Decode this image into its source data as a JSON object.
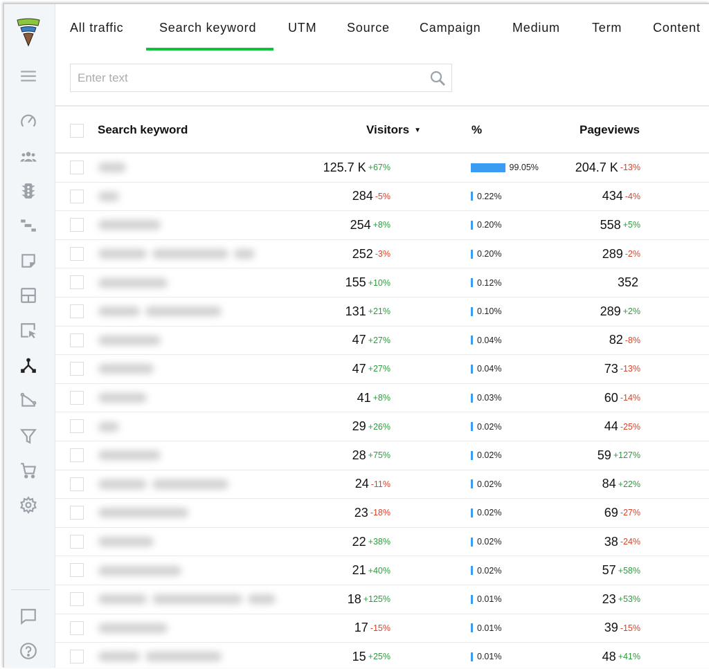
{
  "sidebar": {
    "logo": "funnel-logo",
    "items": [
      {
        "name": "menu",
        "icon": "hamburger-menu-icon",
        "active": false
      },
      {
        "name": "dashboard",
        "icon": "speedometer-icon",
        "active": false
      },
      {
        "name": "visitors",
        "icon": "users-group-icon",
        "active": false
      },
      {
        "name": "traffic",
        "icon": "traffic-light-icon",
        "active": false
      },
      {
        "name": "timeline",
        "icon": "gantt-steps-icon",
        "active": false
      },
      {
        "name": "notes",
        "icon": "sticky-note-icon",
        "active": false
      },
      {
        "name": "layout",
        "icon": "layout-grid-icon",
        "active": false
      },
      {
        "name": "clicks",
        "icon": "cursor-click-icon",
        "active": false
      },
      {
        "name": "utm",
        "icon": "branch-nodes-icon",
        "active": true
      },
      {
        "name": "trends",
        "icon": "trend-line-icon",
        "active": false
      },
      {
        "name": "funnels",
        "icon": "funnel-filter-icon",
        "active": false
      },
      {
        "name": "ecommerce",
        "icon": "shopping-cart-icon",
        "active": false
      },
      {
        "name": "settings",
        "icon": "gear-icon",
        "active": false
      }
    ],
    "bottom_items": [
      {
        "name": "feedback",
        "icon": "chat-bubble-icon"
      },
      {
        "name": "help",
        "icon": "help-circle-icon"
      }
    ],
    "colors": {
      "icon": "#9aa1a8",
      "active_icon": "#222222"
    }
  },
  "tabs": [
    {
      "label": "All traffic",
      "active": false
    },
    {
      "label": "Search keyword",
      "active": true
    },
    {
      "label": "UTM",
      "active": false
    },
    {
      "label": "Source",
      "active": false
    },
    {
      "label": "Campaign",
      "active": false
    },
    {
      "label": "Medium",
      "active": false
    },
    {
      "label": "Term",
      "active": false
    },
    {
      "label": "Content",
      "active": false
    }
  ],
  "accent_color": "#12c13a",
  "search": {
    "placeholder": "Enter text",
    "value": ""
  },
  "table": {
    "columns": {
      "keyword": "Search keyword",
      "visitors": "Visitors",
      "visitors_sort": "▼",
      "percent": "%",
      "pageviews": "Pageviews"
    },
    "colors": {
      "up": "#2e9a3e",
      "down": "#d8432a",
      "bar": "#3a9cf2"
    },
    "rows": [
      {
        "keyword": "[redacted]",
        "visitors": "125.7 K",
        "visitors_delta": "+67%",
        "percent": "99.05%",
        "percent_value": 99.05,
        "pageviews": "204.7 K",
        "pageviews_delta": "-13%"
      },
      {
        "keyword": "[redacted]",
        "visitors": "284",
        "visitors_delta": "-5%",
        "percent": "0.22%",
        "percent_value": 0.22,
        "pageviews": "434",
        "pageviews_delta": "-4%"
      },
      {
        "keyword": "[redacted]",
        "visitors": "254",
        "visitors_delta": "+8%",
        "percent": "0.20%",
        "percent_value": 0.2,
        "pageviews": "558",
        "pageviews_delta": "+5%"
      },
      {
        "keyword": "[redacted]",
        "visitors": "252",
        "visitors_delta": "-3%",
        "percent": "0.20%",
        "percent_value": 0.2,
        "pageviews": "289",
        "pageviews_delta": "-2%"
      },
      {
        "keyword": "[redacted]",
        "visitors": "155",
        "visitors_delta": "+10%",
        "percent": "0.12%",
        "percent_value": 0.12,
        "pageviews": "352",
        "pageviews_delta": ""
      },
      {
        "keyword": "[redacted]",
        "visitors": "131",
        "visitors_delta": "+21%",
        "percent": "0.10%",
        "percent_value": 0.1,
        "pageviews": "289",
        "pageviews_delta": "+2%"
      },
      {
        "keyword": "[redacted]",
        "visitors": "47",
        "visitors_delta": "+27%",
        "percent": "0.04%",
        "percent_value": 0.04,
        "pageviews": "82",
        "pageviews_delta": "-8%"
      },
      {
        "keyword": "[redacted]",
        "visitors": "47",
        "visitors_delta": "+27%",
        "percent": "0.04%",
        "percent_value": 0.04,
        "pageviews": "73",
        "pageviews_delta": "-13%"
      },
      {
        "keyword": "[redacted]",
        "visitors": "41",
        "visitors_delta": "+8%",
        "percent": "0.03%",
        "percent_value": 0.03,
        "pageviews": "60",
        "pageviews_delta": "-14%"
      },
      {
        "keyword": "[redacted]",
        "visitors": "29",
        "visitors_delta": "+26%",
        "percent": "0.02%",
        "percent_value": 0.02,
        "pageviews": "44",
        "pageviews_delta": "-25%"
      },
      {
        "keyword": "[redacted]",
        "visitors": "28",
        "visitors_delta": "+75%",
        "percent": "0.02%",
        "percent_value": 0.02,
        "pageviews": "59",
        "pageviews_delta": "+127%"
      },
      {
        "keyword": "[redacted]",
        "visitors": "24",
        "visitors_delta": "-11%",
        "percent": "0.02%",
        "percent_value": 0.02,
        "pageviews": "84",
        "pageviews_delta": "+22%"
      },
      {
        "keyword": "[redacted]",
        "visitors": "23",
        "visitors_delta": "-18%",
        "percent": "0.02%",
        "percent_value": 0.02,
        "pageviews": "69",
        "pageviews_delta": "-27%"
      },
      {
        "keyword": "[redacted]",
        "visitors": "22",
        "visitors_delta": "+38%",
        "percent": "0.02%",
        "percent_value": 0.02,
        "pageviews": "38",
        "pageviews_delta": "-24%"
      },
      {
        "keyword": "[redacted]",
        "visitors": "21",
        "visitors_delta": "+40%",
        "percent": "0.02%",
        "percent_value": 0.02,
        "pageviews": "57",
        "pageviews_delta": "+58%"
      },
      {
        "keyword": "[redacted]",
        "visitors": "18",
        "visitors_delta": "+125%",
        "percent": "0.01%",
        "percent_value": 0.01,
        "pageviews": "23",
        "pageviews_delta": "+53%"
      },
      {
        "keyword": "[redacted]",
        "visitors": "17",
        "visitors_delta": "-15%",
        "percent": "0.01%",
        "percent_value": 0.01,
        "pageviews": "39",
        "pageviews_delta": "-15%"
      },
      {
        "keyword": "[redacted]",
        "visitors": "15",
        "visitors_delta": "+25%",
        "percent": "0.01%",
        "percent_value": 0.01,
        "pageviews": "48",
        "pageviews_delta": "+41%"
      }
    ]
  }
}
